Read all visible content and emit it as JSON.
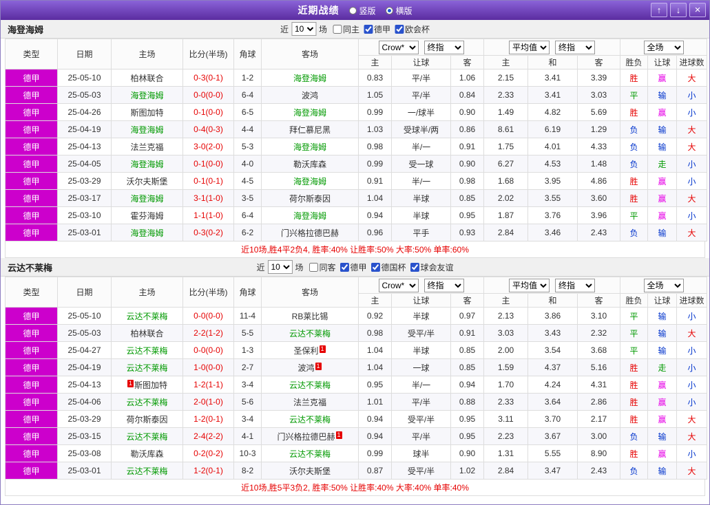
{
  "titlebar": {
    "title": "近期战绩",
    "radio_vertical": "竖版",
    "radio_horizontal": "横版",
    "selected": "横版",
    "up_icon": "↑",
    "down_icon": "↓",
    "close_icon": "×"
  },
  "ui": {
    "near_label": "近",
    "games_label": "场"
  },
  "headers": {
    "type": "类型",
    "date": "日期",
    "home": "主场",
    "score": "比分(半场)",
    "corner": "角球",
    "away": "客场",
    "bookmaker": "Crow*",
    "index_final": "终指",
    "average": "平均值",
    "scope": "全场",
    "h_home": "主",
    "handicap": "让球",
    "h_away": "客",
    "a_home": "主",
    "a_draw": "和",
    "a_away": "客",
    "outcome": "胜负",
    "goals": "进球数"
  },
  "colors": {
    "titlebar_purple": "#6a3ab2",
    "type_bg": "#cc00cc",
    "focus_team": "#009900",
    "score": "#e60000",
    "win": "#e60000",
    "draw": "#009900",
    "lose": "#0033cc",
    "hwin": "#e600e6",
    "hlose": "#0033cc",
    "hpush": "#009900",
    "over": "#e60000",
    "under": "#0033cc"
  },
  "sections": [
    {
      "team": "海登海姆",
      "filters": {
        "count": "10",
        "checks": [
          {
            "label": "同主",
            "checked": false
          },
          {
            "label": "德甲",
            "checked": true
          },
          {
            "label": "欧会杯",
            "checked": true
          }
        ]
      },
      "rows": [
        {
          "league": "德甲",
          "date": "25-05-10",
          "home": "柏林联合",
          "home_focus": false,
          "home_card": "",
          "score": "0-3(0-1)",
          "corner": "1-2",
          "away": "海登海姆",
          "away_focus": true,
          "away_card": "",
          "crown": [
            "0.83",
            "平/半",
            "1.06"
          ],
          "avg": [
            "2.15",
            "3.41",
            "3.39"
          ],
          "result": [
            "胜",
            "赢",
            "大"
          ]
        },
        {
          "league": "德甲",
          "date": "25-05-03",
          "home": "海登海姆",
          "home_focus": true,
          "home_card": "",
          "score": "0-0(0-0)",
          "corner": "6-4",
          "away": "波鸿",
          "away_focus": false,
          "away_card": "",
          "crown": [
            "1.05",
            "平/半",
            "0.84"
          ],
          "avg": [
            "2.33",
            "3.41",
            "3.03"
          ],
          "result": [
            "平",
            "输",
            "小"
          ]
        },
        {
          "league": "德甲",
          "date": "25-04-26",
          "home": "斯图加特",
          "home_focus": false,
          "home_card": "",
          "score": "0-1(0-0)",
          "corner": "6-5",
          "away": "海登海姆",
          "away_focus": true,
          "away_card": "",
          "crown": [
            "0.99",
            "一/球半",
            "0.90"
          ],
          "avg": [
            "1.49",
            "4.82",
            "5.69"
          ],
          "result": [
            "胜",
            "赢",
            "小"
          ]
        },
        {
          "league": "德甲",
          "date": "25-04-19",
          "home": "海登海姆",
          "home_focus": true,
          "home_card": "",
          "score": "0-4(0-3)",
          "corner": "4-4",
          "away": "拜仁慕尼黑",
          "away_focus": false,
          "away_card": "",
          "crown": [
            "1.03",
            "受球半/两",
            "0.86"
          ],
          "avg": [
            "8.61",
            "6.19",
            "1.29"
          ],
          "result": [
            "负",
            "输",
            "大"
          ]
        },
        {
          "league": "德甲",
          "date": "25-04-13",
          "home": "法兰克福",
          "home_focus": false,
          "home_card": "",
          "score": "3-0(2-0)",
          "corner": "5-3",
          "away": "海登海姆",
          "away_focus": true,
          "away_card": "",
          "crown": [
            "0.98",
            "半/一",
            "0.91"
          ],
          "avg": [
            "1.75",
            "4.01",
            "4.33"
          ],
          "result": [
            "负",
            "输",
            "大"
          ]
        },
        {
          "league": "德甲",
          "date": "25-04-05",
          "home": "海登海姆",
          "home_focus": true,
          "home_card": "",
          "score": "0-1(0-0)",
          "corner": "4-0",
          "away": "勒沃库森",
          "away_focus": false,
          "away_card": "",
          "crown": [
            "0.99",
            "受一球",
            "0.90"
          ],
          "avg": [
            "6.27",
            "4.53",
            "1.48"
          ],
          "result": [
            "负",
            "走",
            "小"
          ]
        },
        {
          "league": "德甲",
          "date": "25-03-29",
          "home": "沃尔夫斯堡",
          "home_focus": false,
          "home_card": "",
          "score": "0-1(0-1)",
          "corner": "4-5",
          "away": "海登海姆",
          "away_focus": true,
          "away_card": "",
          "crown": [
            "0.91",
            "半/一",
            "0.98"
          ],
          "avg": [
            "1.68",
            "3.95",
            "4.86"
          ],
          "result": [
            "胜",
            "赢",
            "小"
          ]
        },
        {
          "league": "德甲",
          "date": "25-03-17",
          "home": "海登海姆",
          "home_focus": true,
          "home_card": "",
          "score": "3-1(1-0)",
          "corner": "3-5",
          "away": "荷尔斯泰因",
          "away_focus": false,
          "away_card": "",
          "crown": [
            "1.04",
            "半球",
            "0.85"
          ],
          "avg": [
            "2.02",
            "3.55",
            "3.60"
          ],
          "result": [
            "胜",
            "赢",
            "大"
          ]
        },
        {
          "league": "德甲",
          "date": "25-03-10",
          "home": "霍芬海姆",
          "home_focus": false,
          "home_card": "",
          "score": "1-1(1-0)",
          "corner": "6-4",
          "away": "海登海姆",
          "away_focus": true,
          "away_card": "",
          "crown": [
            "0.94",
            "半球",
            "0.95"
          ],
          "avg": [
            "1.87",
            "3.76",
            "3.96"
          ],
          "result": [
            "平",
            "赢",
            "小"
          ]
        },
        {
          "league": "德甲",
          "date": "25-03-01",
          "home": "海登海姆",
          "home_focus": true,
          "home_card": "",
          "score": "0-3(0-2)",
          "corner": "6-2",
          "away": "门兴格拉德巴赫",
          "away_focus": false,
          "away_card": "",
          "crown": [
            "0.96",
            "平手",
            "0.93"
          ],
          "avg": [
            "2.84",
            "3.46",
            "2.43"
          ],
          "result": [
            "负",
            "输",
            "大"
          ]
        }
      ],
      "summary": "近10场,胜4平2负4, 胜率:40% 让胜率:50% 大率:50% 单率:60%"
    },
    {
      "team": "云达不莱梅",
      "filters": {
        "count": "10",
        "checks": [
          {
            "label": "同客",
            "checked": false
          },
          {
            "label": "德甲",
            "checked": true
          },
          {
            "label": "德国杯",
            "checked": true
          },
          {
            "label": "球会友谊",
            "checked": true
          }
        ]
      },
      "rows": [
        {
          "league": "德甲",
          "date": "25-05-10",
          "home": "云达不莱梅",
          "home_focus": true,
          "home_card": "",
          "score": "0-0(0-0)",
          "corner": "11-4",
          "away": "RB莱比锡",
          "away_focus": false,
          "away_card": "",
          "crown": [
            "0.92",
            "半球",
            "0.97"
          ],
          "avg": [
            "2.13",
            "3.86",
            "3.10"
          ],
          "result": [
            "平",
            "输",
            "小"
          ]
        },
        {
          "league": "德甲",
          "date": "25-05-03",
          "home": "柏林联合",
          "home_focus": false,
          "home_card": "",
          "score": "2-2(1-2)",
          "corner": "5-5",
          "away": "云达不莱梅",
          "away_focus": true,
          "away_card": "",
          "crown": [
            "0.98",
            "受平/半",
            "0.91"
          ],
          "avg": [
            "3.03",
            "3.43",
            "2.32"
          ],
          "result": [
            "平",
            "输",
            "大"
          ]
        },
        {
          "league": "德甲",
          "date": "25-04-27",
          "home": "云达不莱梅",
          "home_focus": true,
          "home_card": "",
          "score": "0-0(0-0)",
          "corner": "1-3",
          "away": "圣保利",
          "away_focus": false,
          "away_card": "1",
          "crown": [
            "1.04",
            "半球",
            "0.85"
          ],
          "avg": [
            "2.00",
            "3.54",
            "3.68"
          ],
          "result": [
            "平",
            "输",
            "小"
          ]
        },
        {
          "league": "德甲",
          "date": "25-04-19",
          "home": "云达不莱梅",
          "home_focus": true,
          "home_card": "",
          "score": "1-0(0-0)",
          "corner": "2-7",
          "away": "波鸿",
          "away_focus": false,
          "away_card": "1",
          "crown": [
            "1.04",
            "一球",
            "0.85"
          ],
          "avg": [
            "1.59",
            "4.37",
            "5.16"
          ],
          "result": [
            "胜",
            "走",
            "小"
          ]
        },
        {
          "league": "德甲",
          "date": "25-04-13",
          "home": "斯图加特",
          "home_focus": false,
          "home_card": "1",
          "score": "1-2(1-1)",
          "corner": "3-4",
          "away": "云达不莱梅",
          "away_focus": true,
          "away_card": "",
          "crown": [
            "0.95",
            "半/一",
            "0.94"
          ],
          "avg": [
            "1.70",
            "4.24",
            "4.31"
          ],
          "result": [
            "胜",
            "赢",
            "小"
          ]
        },
        {
          "league": "德甲",
          "date": "25-04-06",
          "home": "云达不莱梅",
          "home_focus": true,
          "home_card": "",
          "score": "2-0(1-0)",
          "corner": "5-6",
          "away": "法兰克福",
          "away_focus": false,
          "away_card": "",
          "crown": [
            "1.01",
            "平/半",
            "0.88"
          ],
          "avg": [
            "2.33",
            "3.64",
            "2.86"
          ],
          "result": [
            "胜",
            "赢",
            "小"
          ]
        },
        {
          "league": "德甲",
          "date": "25-03-29",
          "home": "荷尔斯泰因",
          "home_focus": false,
          "home_card": "",
          "score": "1-2(0-1)",
          "corner": "3-4",
          "away": "云达不莱梅",
          "away_focus": true,
          "away_card": "",
          "crown": [
            "0.94",
            "受平/半",
            "0.95"
          ],
          "avg": [
            "3.11",
            "3.70",
            "2.17"
          ],
          "result": [
            "胜",
            "赢",
            "大"
          ]
        },
        {
          "league": "德甲",
          "date": "25-03-15",
          "home": "云达不莱梅",
          "home_focus": true,
          "home_card": "",
          "score": "2-4(2-2)",
          "corner": "4-1",
          "away": "门兴格拉德巴赫",
          "away_focus": false,
          "away_card": "1",
          "crown": [
            "0.94",
            "平/半",
            "0.95"
          ],
          "avg": [
            "2.23",
            "3.67",
            "3.00"
          ],
          "result": [
            "负",
            "输",
            "大"
          ]
        },
        {
          "league": "德甲",
          "date": "25-03-08",
          "home": "勒沃库森",
          "home_focus": false,
          "home_card": "",
          "score": "0-2(0-2)",
          "corner": "10-3",
          "away": "云达不莱梅",
          "away_focus": true,
          "away_card": "",
          "crown": [
            "0.99",
            "球半",
            "0.90"
          ],
          "avg": [
            "1.31",
            "5.55",
            "8.90"
          ],
          "result": [
            "胜",
            "赢",
            "小"
          ]
        },
        {
          "league": "德甲",
          "date": "25-03-01",
          "home": "云达不莱梅",
          "home_focus": true,
          "home_card": "",
          "score": "1-2(0-1)",
          "corner": "8-2",
          "away": "沃尔夫斯堡",
          "away_focus": false,
          "away_card": "",
          "crown": [
            "0.87",
            "受平/半",
            "1.02"
          ],
          "avg": [
            "2.84",
            "3.47",
            "2.43"
          ],
          "result": [
            "负",
            "输",
            "大"
          ]
        }
      ],
      "summary": "近10场,胜5平3负2, 胜率:50% 让胜率:40% 大率:40% 单率:40%"
    }
  ]
}
